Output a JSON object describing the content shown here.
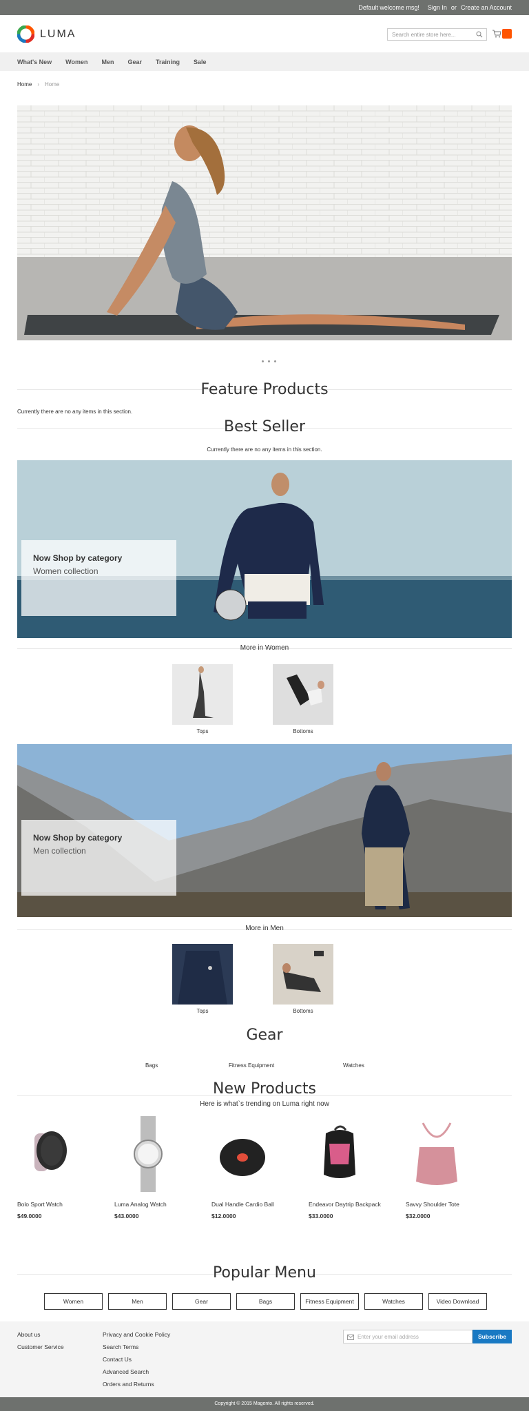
{
  "topbar": {
    "welcome": "Default welcome msg!",
    "sign_in": "Sign In",
    "or": "or",
    "create_account": "Create an Account"
  },
  "header": {
    "logo_text": "LUMA",
    "search_placeholder": "Search entire store here...",
    "brand_color": "#ff5501"
  },
  "nav": {
    "items": [
      "What's New",
      "Women",
      "Men",
      "Gear",
      "Training",
      "Sale"
    ]
  },
  "breadcrumb": {
    "home": "Home",
    "current": "Home"
  },
  "sections": {
    "feature_title": "Feature Products",
    "feature_empty": "Currently there are no any items in this section.",
    "bestseller_title": "Best Seller",
    "bestseller_empty": "Currently there are no any items in this section."
  },
  "women_banner": {
    "line1": "Now Shop by category",
    "line2": "Women collection",
    "more_title": "More in Women",
    "cats": [
      "Tops",
      "Bottoms"
    ]
  },
  "men_banner": {
    "line1": "Now Shop by category",
    "line2": "Men collection",
    "more_title": "More in Men",
    "cats": [
      "Tops",
      "Bottoms"
    ]
  },
  "gear": {
    "title": "Gear",
    "links": [
      "Bags",
      "Fitness Equipment",
      "Watches"
    ]
  },
  "new_products": {
    "title": "New Products",
    "subtitle": "Here is what`s trending on Luma right now",
    "items": [
      {
        "name": "Bolo Sport Watch",
        "price": "$49.0000"
      },
      {
        "name": "Luma Analog Watch",
        "price": "$43.0000"
      },
      {
        "name": "Dual Handle Cardio Ball",
        "price": "$12.0000"
      },
      {
        "name": "Endeavor Daytrip Backpack",
        "price": "$33.0000"
      },
      {
        "name": "Savvy Shoulder Tote",
        "price": "$32.0000"
      }
    ]
  },
  "popular_menu": {
    "title": "Popular Menu",
    "items": [
      "Women",
      "Men",
      "Gear",
      "Bags",
      "Fitness Equipment",
      "Watches",
      "Video Download"
    ]
  },
  "footer": {
    "col1": [
      "About us",
      "Customer Service"
    ],
    "col2": [
      "Privacy and Cookie Policy",
      "Search Terms",
      "Contact Us",
      "Advanced Search",
      "Orders and Returns"
    ],
    "newsletter_placeholder": "Enter your email address",
    "subscribe": "Subscribe",
    "copyright": "Copyright © 2015 Magento. All rights reserved."
  }
}
